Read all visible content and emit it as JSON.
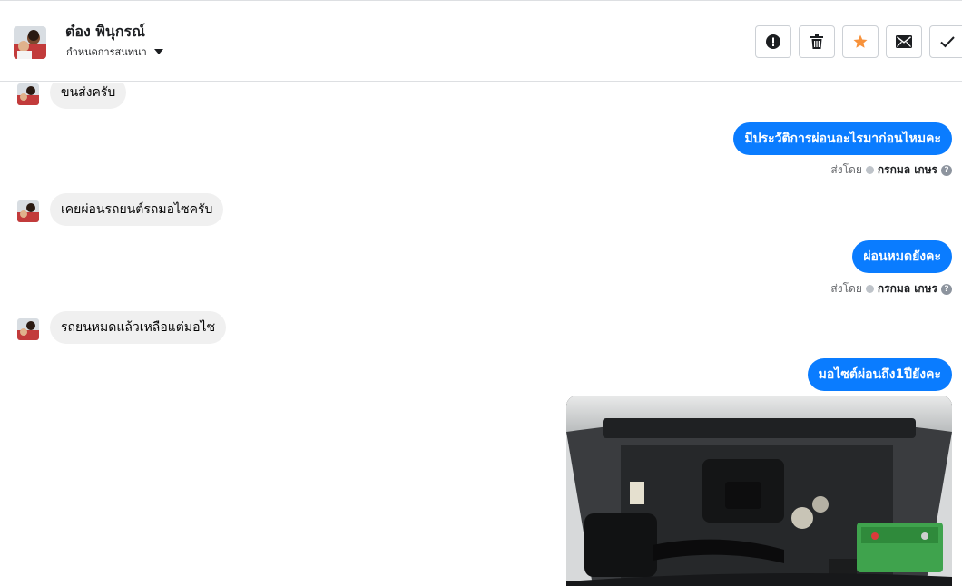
{
  "header": {
    "contact_name": "ต๋อง พินุกรณ์",
    "assign_label": "กำหนดการสนทนา"
  },
  "actions": [
    {
      "name": "spam-button",
      "icon": "alert-icon"
    },
    {
      "name": "delete-button",
      "icon": "trash-icon"
    },
    {
      "name": "star-button",
      "icon": "star-icon",
      "color": "#f7923b"
    },
    {
      "name": "mark-unread-button",
      "icon": "envelope-icon"
    },
    {
      "name": "mark-done-button",
      "icon": "check-icon"
    }
  ],
  "messages": [
    {
      "dir": "in",
      "text": "ขนส่งครับ"
    },
    {
      "dir": "out",
      "text": "มีประวัติการผ่อนอะไรมาก่อนไหมคะ",
      "sent_by_label": "ส่งโดย",
      "sent_by": "กรกมล เกษร"
    },
    {
      "dir": "in",
      "text": "เคยผ่อนรถยนต์รถมอไซครับ"
    },
    {
      "dir": "out",
      "text": "ผ่อนหมดยังคะ",
      "sent_by_label": "ส่งโดย",
      "sent_by": "กรกมล เกษร"
    },
    {
      "dir": "in",
      "text": "รถยนหมดแล้วเหลือแต่มอไซ"
    },
    {
      "dir": "out",
      "text": "มอไซต์ผ่อนถึง1ปียังคะ"
    }
  ],
  "attachment": {
    "type": "photo",
    "subject": "engine bay"
  },
  "colors": {
    "outgoing_bubble": "#0a7cff",
    "incoming_bubble": "#f0f0f0",
    "star": "#f7923b"
  }
}
